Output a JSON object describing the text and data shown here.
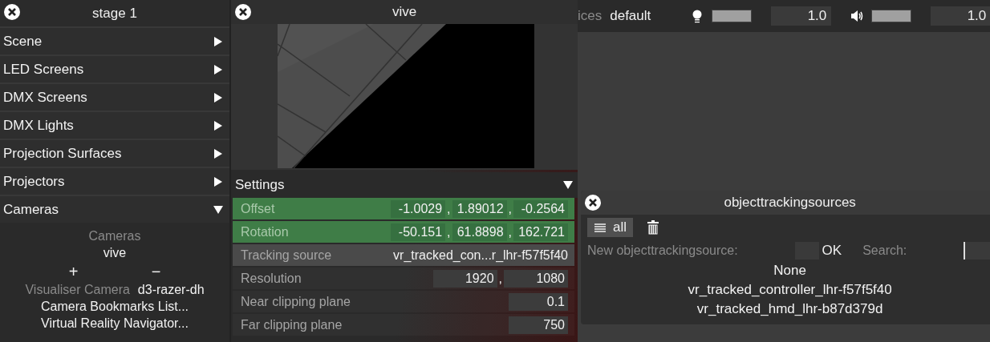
{
  "stage_panel": {
    "title": "stage 1",
    "sections": [
      {
        "label": "Scene",
        "expanded": false
      },
      {
        "label": "LED Screens",
        "expanded": false
      },
      {
        "label": "DMX Screens",
        "expanded": false
      },
      {
        "label": "DMX Lights",
        "expanded": false
      },
      {
        "label": "Projection Surfaces",
        "expanded": false
      },
      {
        "label": "Projectors",
        "expanded": false
      },
      {
        "label": "Cameras",
        "expanded": true
      }
    ],
    "cameras": {
      "heading": "Cameras",
      "items": [
        "vive"
      ],
      "add": "+",
      "remove": "−",
      "visualiser_label": "Visualiser Camera",
      "visualiser_value": "d3-razer-dh",
      "links": [
        "Camera Bookmarks List...",
        "Virtual Reality Navigator..."
      ]
    }
  },
  "vive_panel": {
    "title": "vive",
    "settings": {
      "title": "Settings",
      "expanded": true,
      "rows": [
        {
          "label": "Offset",
          "kind": "vector",
          "highlighted": true,
          "values": [
            "-1.0029",
            "1.89012",
            "-0.2564"
          ],
          "separator": ","
        },
        {
          "label": "Rotation",
          "kind": "vector",
          "highlighted": true,
          "values": [
            "-50.151",
            "61.8898",
            "162.721"
          ],
          "separator": ","
        },
        {
          "label": "Tracking source",
          "kind": "select",
          "highlighted": false,
          "value": "vr_tracked_con...r_lhr-f57f5f40"
        },
        {
          "label": "Resolution",
          "kind": "vector",
          "highlighted": false,
          "values": [
            "1920",
            "1080"
          ],
          "separator": ","
        },
        {
          "label": "Near clipping plane",
          "kind": "number",
          "highlighted": false,
          "value": "0.1"
        },
        {
          "label": "Far clipping plane",
          "kind": "number",
          "highlighted": false,
          "value": "750"
        }
      ]
    }
  },
  "top_bar": {
    "devices_label": "ices",
    "devices_value": "default",
    "brightness": {
      "level": 1,
      "value": "1.0"
    },
    "volume": {
      "level": 1,
      "value": "1.0"
    }
  },
  "tracking_sources_panel": {
    "title": "objecttrackingsources",
    "filter": "all",
    "new_label": "New objecttrackingsource:",
    "ok": "OK",
    "search_label": "Search:",
    "items": [
      "None",
      "vr_tracked_controller_lhr-f57f5f40",
      "vr_tracked_hmd_lhr-b87d379d"
    ]
  }
}
